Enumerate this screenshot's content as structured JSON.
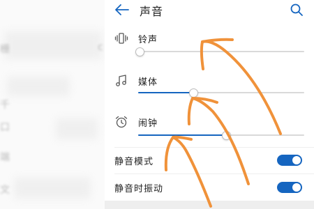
{
  "header": {
    "title": "声音",
    "back_icon": "arrow-left-icon",
    "search_icon": "search-icon"
  },
  "volumes": [
    {
      "label": "铃声",
      "icon": "vibrate-phone-icon",
      "level": 0.01
    },
    {
      "label": "媒体",
      "icon": "music-note-icon",
      "level": 0.33
    },
    {
      "label": "闹钟",
      "icon": "alarm-clock-icon",
      "level": 0.53
    }
  ],
  "toggles": [
    {
      "label": "静音模式",
      "on": true
    },
    {
      "label": "静音时振动",
      "on": true
    }
  ],
  "background_page": {
    "visible_chars": [
      "栅",
      "c",
      "千",
      "口",
      "端",
      "文"
    ]
  },
  "colors": {
    "accent": "#1565c0",
    "annotation": "#f0923a",
    "track": "#d9d9d9"
  }
}
